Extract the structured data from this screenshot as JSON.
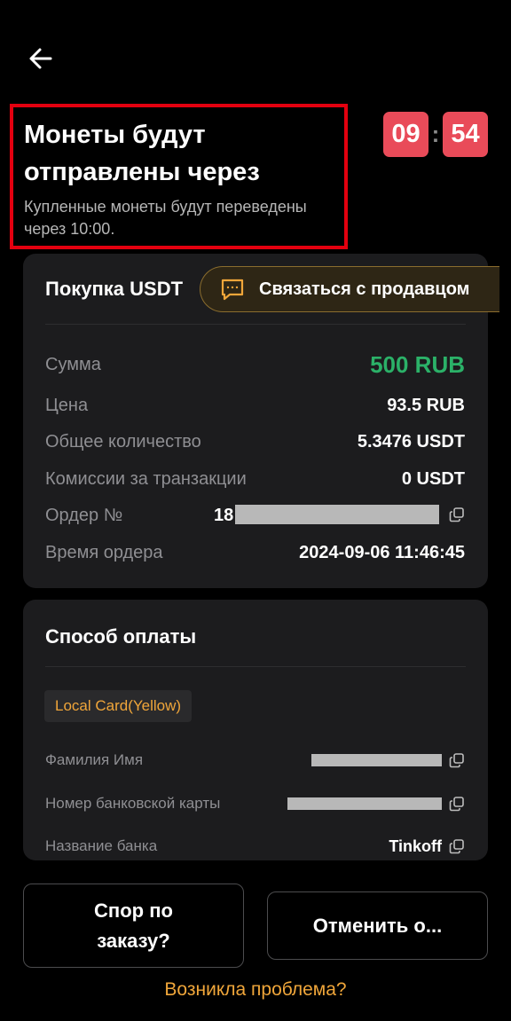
{
  "header": {
    "title_line1": "Монеты будут",
    "title_line2": "отправлены через",
    "subtitle": "Купленные монеты будут переведены через 10:00."
  },
  "timer": {
    "minutes": "09",
    "separator": ":",
    "seconds": "54"
  },
  "order_card": {
    "title": "Покупка USDT",
    "contact_seller": "Связаться с продавцом",
    "rows": [
      {
        "label": "Сумма",
        "value": "500 RUB"
      },
      {
        "label": "Цена",
        "value": "93.5 RUB"
      },
      {
        "label": "Общее количество",
        "value": "5.3476 USDT"
      },
      {
        "label": "Комиссии за транзакции",
        "value": "0 USDT"
      },
      {
        "label": "Ордер №",
        "value": "18"
      },
      {
        "label": "Время ордера",
        "value": "2024-09-06 11:46:45"
      }
    ]
  },
  "payment_card": {
    "title": "Способ оплаты",
    "method_badge": "Local Card(Yellow)",
    "rows": [
      {
        "label": "Фамилия Имя",
        "value": ""
      },
      {
        "label": "Номер банковской карты",
        "value": ""
      },
      {
        "label": "Название банка",
        "value": "Tinkoff"
      }
    ]
  },
  "buttons": {
    "dispute_line1": "Спор по",
    "dispute_line2": "заказу?",
    "cancel": "Отменить о..."
  },
  "problem_link": "Возникла проблема?",
  "colors": {
    "accent_orange": "#f0a63a",
    "timer_red": "#e94b59",
    "amount_green": "#2bb168",
    "highlight_red": "#e3000f"
  }
}
